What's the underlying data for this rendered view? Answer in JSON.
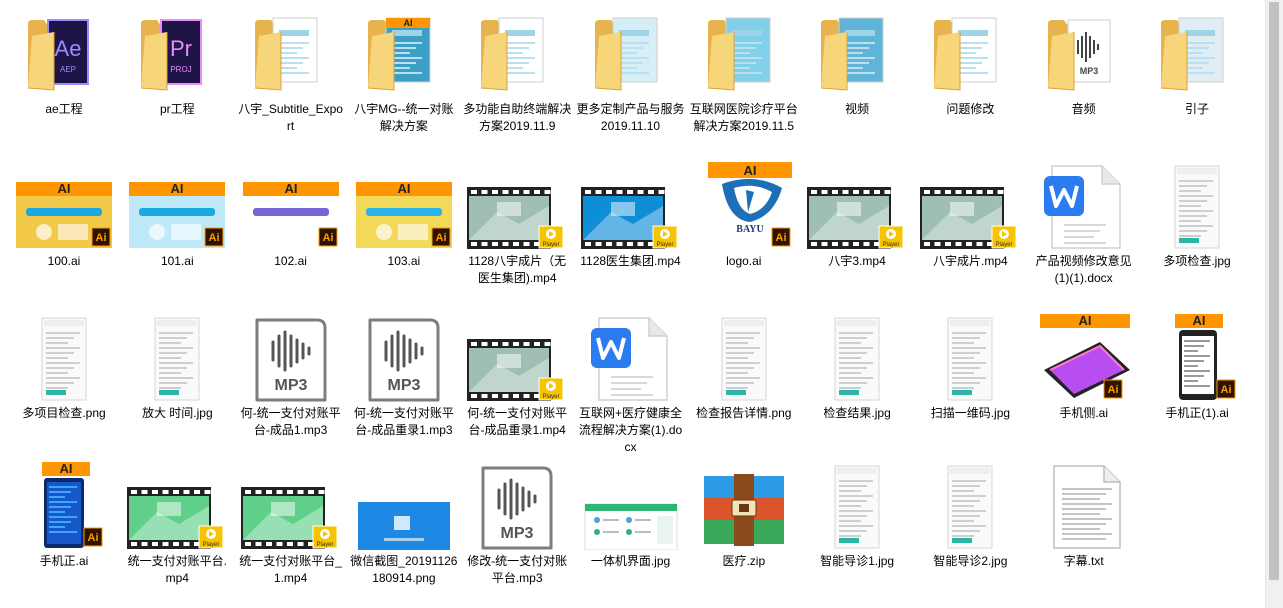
{
  "items": [
    {
      "label": "ae工程",
      "type": "folder",
      "icon": "ae-folder-icon",
      "accent": "#9a8cff",
      "pagebg": "#1e1446",
      "pagetext": "Ae",
      "subtext": "AEP"
    },
    {
      "label": "pr工程",
      "type": "folder",
      "icon": "pr-folder-icon",
      "accent": "#e58cff",
      "pagebg": "#1e1446",
      "pagetext": "Pr",
      "subtext": "PROJ"
    },
    {
      "label": "八宇_Subtitle_Export",
      "type": "folder",
      "icon": "folder-icon",
      "pagebg": "#ffffff"
    },
    {
      "label": "八宇MG--统一对账解决方案",
      "type": "folder",
      "icon": "ai-folder-icon",
      "pagebg": "#3aa0c8",
      "tag": "AI"
    },
    {
      "label": "多功能自助终端解决方案2019.11.9",
      "type": "folder",
      "icon": "doc-folder-icon",
      "pagebg": "#ffffff"
    },
    {
      "label": "更多定制产品与服务2019.11.10",
      "type": "folder",
      "icon": "doc-folder-icon",
      "pagebg": "#d6eef6"
    },
    {
      "label": "互联网医院诊疗平台解决方案2019.11.5",
      "type": "folder",
      "icon": "phone-folder-icon",
      "pagebg": "#7fd0e8"
    },
    {
      "label": "视频",
      "type": "folder",
      "icon": "video-folder-icon",
      "pagebg": "#60b4d8"
    },
    {
      "label": "问题修改",
      "type": "folder",
      "icon": "person-folder-icon",
      "pagebg": "#ffffff"
    },
    {
      "label": "音频",
      "type": "folder",
      "icon": "audio-folder-icon",
      "pagebg": "#ffffff",
      "pagetext": "MP3"
    },
    {
      "label": "引子",
      "type": "folder",
      "icon": "scene-folder-icon",
      "pagebg": "#e0eef4"
    },
    {
      "label": "100.ai",
      "type": "ai",
      "icon": "ai-file-icon",
      "bg": "#f3c94a",
      "accent": "#1aa9e0"
    },
    {
      "label": "101.ai",
      "type": "ai",
      "icon": "ai-file-icon",
      "bg": "#bfe8f8",
      "accent": "#1aa9e0"
    },
    {
      "label": "102.ai",
      "type": "ai",
      "icon": "ai-file-icon",
      "bg": "#ffffff",
      "accent": "#7a64d6"
    },
    {
      "label": "103.ai",
      "type": "ai",
      "icon": "ai-file-icon",
      "bg": "#f3d95a",
      "accent": "#2bb4ea"
    },
    {
      "label": "1128八宇成片（无医生集团).mp4",
      "type": "video",
      "icon": "video-file-icon",
      "scene": "#9fbfb4"
    },
    {
      "label": "1128医生集团.mp4",
      "type": "video",
      "icon": "video-file-icon",
      "scene": "#0e8ed6"
    },
    {
      "label": "logo.ai",
      "type": "logo",
      "icon": "logo-file-icon",
      "tag": "AI",
      "brand": "BAYU"
    },
    {
      "label": "八宇3.mp4",
      "type": "video",
      "icon": "video-file-icon",
      "scene": "#9fbfb4"
    },
    {
      "label": "八宇成片.mp4",
      "type": "video",
      "icon": "video-file-icon",
      "scene": "#9fbfb4"
    },
    {
      "label": "产品视频修改意见(1)(1).docx",
      "type": "word",
      "icon": "word-file-icon"
    },
    {
      "label": "多项检查.jpg",
      "type": "screen",
      "icon": "image-file-icon"
    },
    {
      "label": "多项目检查.png",
      "type": "screen",
      "icon": "image-file-icon"
    },
    {
      "label": "放大 时间.jpg",
      "type": "screen",
      "icon": "image-file-icon"
    },
    {
      "label": "何-统一支付对账平台-成品1.mp3",
      "type": "audio",
      "icon": "mp3-file-icon",
      "pagetext": "MP3"
    },
    {
      "label": "何-统一支付对账平台-成品重录1.mp3",
      "type": "audio",
      "icon": "mp3-file-icon",
      "pagetext": "MP3"
    },
    {
      "label": "何-统一支付对账平台-成品重录1.mp4",
      "type": "video",
      "icon": "video-file-icon",
      "scene": "#9fbfb4"
    },
    {
      "label": "互联网+医疗健康全流程解决方案(1).docx",
      "type": "word",
      "icon": "word-file-icon"
    },
    {
      "label": "检查报告详情.png",
      "type": "screen",
      "icon": "image-file-icon"
    },
    {
      "label": "检查结果.jpg",
      "type": "screen",
      "icon": "image-file-icon"
    },
    {
      "label": "扫描一维码.jpg",
      "type": "screen",
      "icon": "image-file-icon"
    },
    {
      "label": "手机侧.ai",
      "type": "phone",
      "icon": "phone-ai-file-icon",
      "tag": "AI"
    },
    {
      "label": "手机正(1).ai",
      "type": "phone-tall",
      "icon": "phone-ai-file-icon",
      "tag": "AI"
    },
    {
      "label": "手机正.ai",
      "type": "phone-dark",
      "icon": "phone-ai-file-icon",
      "tag": "AI"
    },
    {
      "label": "统一支付对账平台.mp4",
      "type": "video",
      "icon": "video-file-icon",
      "scene": "#5fcf8a"
    },
    {
      "label": "统一支付对账平台_1.mp4",
      "type": "video",
      "icon": "video-file-icon",
      "scene": "#5fcf8a"
    },
    {
      "label": "微信截图_20191126180914.png",
      "type": "wechat",
      "icon": "image-file-icon"
    },
    {
      "label": "修改-统一支付对账平台.mp3",
      "type": "audio",
      "icon": "mp3-file-icon",
      "pagetext": "MP3"
    },
    {
      "label": "一体机界面.jpg",
      "type": "kiosk",
      "icon": "image-file-icon"
    },
    {
      "label": "医疗.zip",
      "type": "zip",
      "icon": "winrar-archive-icon"
    },
    {
      "label": "智能导诊1.jpg",
      "type": "screen",
      "icon": "image-file-icon"
    },
    {
      "label": "智能导诊2.jpg",
      "type": "screen",
      "icon": "image-file-icon"
    },
    {
      "label": "字幕.txt",
      "type": "text",
      "icon": "text-file-icon"
    }
  ],
  "badges": {
    "ai": "Ai",
    "player": "Player"
  }
}
